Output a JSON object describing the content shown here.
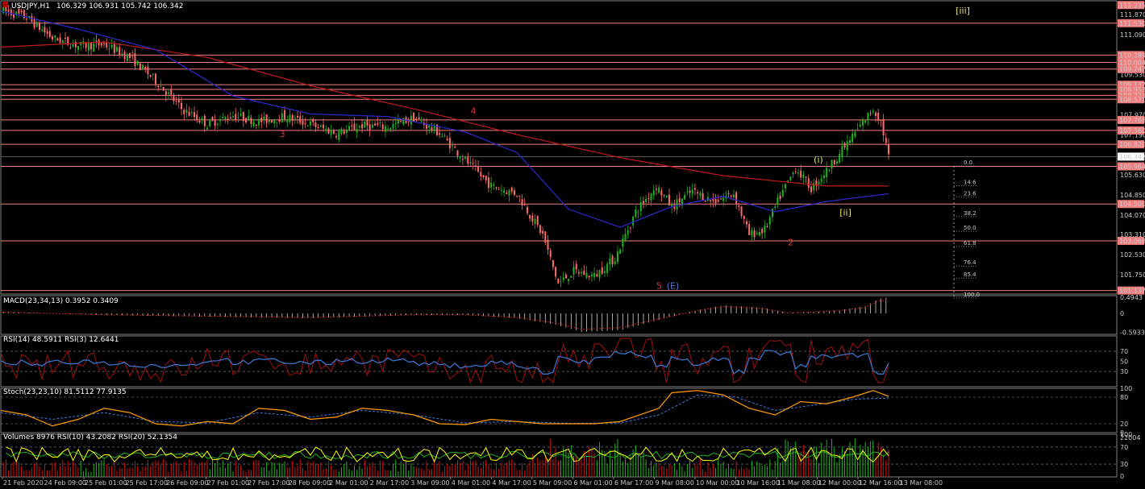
{
  "window": {
    "title": "USDJPY,H1",
    "ohlc": "106.329 106.931 105.742 106.342"
  },
  "colors": {
    "background": "#000000",
    "grid_border": "#808080",
    "bull_candle": "#1fb31f",
    "bear_candle": "#ff6b6b",
    "ma_slow": "#c01a1a",
    "ma_mid": "#2a2ad0",
    "resistance_line": "#f08080",
    "price_tag_bg": "#f08080",
    "current_tag_bg": "#ffffff",
    "wave_red": "#e03030",
    "wave_yellow": "#e8e070",
    "macd_hist": "#d0d0d0",
    "macd_signal": "#c01a1a",
    "rsi14": "#3a7ad8",
    "rsi3": "#a01010",
    "stoch_main": "#ff9a00",
    "stoch_signal": "#3a7ad8",
    "volume_up": "#1fb31f",
    "volume_down": "#d01010",
    "vol_rsi10": "#ffff00",
    "vol_rsi20": "#1fb31f"
  },
  "chart_data": [
    {
      "type": "candlestick",
      "symbol": "USDJPY",
      "timeframe": "H1",
      "title": "USDJPY,H1",
      "ohlc_readout": {
        "open": 106.329,
        "high": 106.931,
        "low": 105.742,
        "close": 106.342
      },
      "ylim": [
        101.0,
        112.4
      ],
      "y_ticks": [
        111.87,
        111.09,
        110.31,
        109.53,
        108.75,
        107.97,
        107.19,
        106.41,
        105.63,
        104.85,
        104.07,
        103.31,
        102.53,
        101.75
      ],
      "price_tags": [
        112.235,
        111.53,
        110.289,
        110.004,
        109.747,
        109.137,
        108.953,
        108.723,
        108.571,
        107.768,
        107.36,
        106.82,
        105.964,
        104.5,
        103.068,
        101.137
      ],
      "horizontal_levels": [
        111.53,
        110.289,
        110.004,
        109.747,
        109.137,
        108.953,
        108.723,
        108.571,
        107.768,
        107.36,
        106.82,
        105.964,
        104.5,
        103.068,
        101.137
      ],
      "current_price": 106.342,
      "x_tick_labels": [
        "21 Feb 2020",
        "24 Feb 09:00",
        "25 Feb 01:00",
        "25 Feb 17:00",
        "26 Feb 09:00",
        "27 Feb 01:00",
        "27 Feb 17:00",
        "28 Feb 09:00",
        "2 Mar 01:00",
        "2 Mar 17:00",
        "3 Mar 09:00",
        "4 Mar 01:00",
        "4 Mar 17:00",
        "5 Mar 09:00",
        "6 Mar 01:00",
        "6 Mar 17:00",
        "9 Mar 08:00",
        "10 Mar 00:00",
        "10 Mar 16:00",
        "11 Mar 08:00",
        "12 Mar 00:00",
        "12 Mar 16:00",
        "13 Mar 08:00"
      ],
      "price_path": [
        [
          0,
          112.05
        ],
        [
          10,
          111.75
        ],
        [
          20,
          110.95
        ],
        [
          30,
          110.65
        ],
        [
          40,
          110.7
        ],
        [
          50,
          110.2
        ],
        [
          60,
          109.3
        ],
        [
          70,
          108.2
        ],
        [
          80,
          107.6
        ],
        [
          90,
          107.95
        ],
        [
          100,
          107.7
        ],
        [
          110,
          107.9
        ],
        [
          120,
          107.6
        ],
        [
          130,
          107.25
        ],
        [
          140,
          107.55
        ],
        [
          150,
          107.5
        ],
        [
          160,
          107.85
        ],
        [
          170,
          107.25
        ],
        [
          180,
          106.2
        ],
        [
          190,
          105.2
        ],
        [
          200,
          104.9
        ],
        [
          210,
          103.3
        ],
        [
          216,
          101.4
        ],
        [
          222,
          101.9
        ],
        [
          230,
          101.7
        ],
        [
          238,
          102.4
        ],
        [
          246,
          104.2
        ],
        [
          254,
          105.2
        ],
        [
          260,
          104.4
        ],
        [
          268,
          105.0
        ],
        [
          276,
          104.6
        ],
        [
          284,
          104.9
        ],
        [
          290,
          103.3
        ],
        [
          296,
          103.5
        ],
        [
          302,
          104.8
        ],
        [
          308,
          105.9
        ],
        [
          314,
          105.1
        ],
        [
          320,
          105.8
        ],
        [
          326,
          106.6
        ],
        [
          332,
          107.4
        ],
        [
          338,
          108.2
        ],
        [
          341,
          107.7
        ],
        [
          344,
          106.34
        ]
      ],
      "ma_slow_path": [
        [
          0,
          110.6
        ],
        [
          40,
          110.8
        ],
        [
          80,
          110.2
        ],
        [
          120,
          109.1
        ],
        [
          160,
          108.2
        ],
        [
          200,
          107.2
        ],
        [
          240,
          106.3
        ],
        [
          280,
          105.6
        ],
        [
          320,
          105.2
        ],
        [
          344,
          105.2
        ]
      ],
      "ma_mid_path": [
        [
          0,
          112.0
        ],
        [
          30,
          111.3
        ],
        [
          60,
          110.5
        ],
        [
          90,
          108.7
        ],
        [
          120,
          108.0
        ],
        [
          150,
          107.9
        ],
        [
          180,
          107.3
        ],
        [
          200,
          106.5
        ],
        [
          220,
          104.3
        ],
        [
          240,
          103.6
        ],
        [
          260,
          104.4
        ],
        [
          280,
          104.8
        ],
        [
          300,
          104.2
        ],
        [
          320,
          104.6
        ],
        [
          344,
          104.9
        ]
      ],
      "wave_labels": [
        {
          "text": "3",
          "x": 108,
          "y": 107.1,
          "color": "#e03030"
        },
        {
          "text": "4",
          "x": 182,
          "y": 108.0,
          "color": "#e03030"
        },
        {
          "text": "5",
          "x": 254,
          "y": 101.2,
          "color": "#e03030"
        },
        {
          "text": "(E)",
          "x": 258,
          "y": 101.2,
          "color": "#5a7ad8"
        },
        {
          "text": "2",
          "x": 305,
          "y": 102.9,
          "color": "#e03030"
        },
        {
          "text": "(i)",
          "x": 315,
          "y": 106.1,
          "color": "#e8e070"
        },
        {
          "text": "[ii]",
          "x": 325,
          "y": 104.05,
          "color": "#e8e070"
        },
        {
          "text": "[iii]",
          "x": 370,
          "y": 111.9,
          "color": "#e8e070"
        }
      ],
      "fibonacci": {
        "levels": [
          "0.0",
          "14.6",
          "23.6",
          "38.2",
          "50.0",
          "61.8",
          "76.4",
          "85.4",
          "100.0"
        ],
        "prices": [
          105.98,
          105.21,
          104.77,
          104.01,
          103.44,
          102.85,
          102.09,
          101.62,
          100.85
        ]
      }
    },
    {
      "type": "bar",
      "title": "MACD(23,34,13) 0.3952 0.3409",
      "name": "MACD(23,34,13)",
      "values_readout": [
        0.3952,
        0.3409
      ],
      "y_ticks": [
        0.4943,
        0.0,
        -0.5933
      ],
      "ylim": [
        -0.65,
        0.55
      ],
      "hist_path": [
        [
          0,
          0.05
        ],
        [
          40,
          -0.05
        ],
        [
          80,
          -0.1
        ],
        [
          120,
          -0.15
        ],
        [
          160,
          -0.05
        ],
        [
          180,
          -0.05
        ],
        [
          200,
          -0.15
        ],
        [
          215,
          -0.35
        ],
        [
          225,
          -0.58
        ],
        [
          240,
          -0.52
        ],
        [
          255,
          -0.2
        ],
        [
          270,
          0.1
        ],
        [
          280,
          0.25
        ],
        [
          295,
          0.18
        ],
        [
          305,
          0.02
        ],
        [
          315,
          0.05
        ],
        [
          325,
          0.1
        ],
        [
          335,
          0.22
        ],
        [
          340,
          0.45
        ],
        [
          344,
          0.5
        ]
      ]
    },
    {
      "type": "line",
      "title": "RSI(14) 48.5911 RSI(3) 12.6441",
      "series": [
        {
          "name": "RSI(14)",
          "readout": 48.5911
        },
        {
          "name": "RSI(3)",
          "readout": 12.6441
        }
      ],
      "y_ticks": [
        70,
        50,
        30
      ],
      "levels": [
        70,
        30
      ],
      "ylim": [
        0,
        100
      ]
    },
    {
      "type": "line",
      "title": "Stoch(23,23,10) 81.5112 77.9135",
      "series": [
        {
          "name": "%K",
          "readout": 81.5112
        },
        {
          "name": "%D",
          "readout": 77.9135
        }
      ],
      "y_ticks": [
        100,
        80,
        20,
        0
      ],
      "levels": [
        80,
        20
      ],
      "ylim": [
        0,
        100
      ],
      "k_path": [
        [
          0,
          50
        ],
        [
          10,
          40
        ],
        [
          20,
          15
        ],
        [
          30,
          30
        ],
        [
          40,
          55
        ],
        [
          50,
          45
        ],
        [
          60,
          20
        ],
        [
          70,
          15
        ],
        [
          80,
          25
        ],
        [
          90,
          20
        ],
        [
          100,
          55
        ],
        [
          110,
          50
        ],
        [
          120,
          30
        ],
        [
          130,
          35
        ],
        [
          140,
          55
        ],
        [
          150,
          50
        ],
        [
          160,
          40
        ],
        [
          170,
          20
        ],
        [
          180,
          18
        ],
        [
          190,
          30
        ],
        [
          200,
          25
        ],
        [
          210,
          20
        ],
        [
          220,
          20
        ],
        [
          230,
          20
        ],
        [
          240,
          25
        ],
        [
          255,
          55
        ],
        [
          260,
          90
        ],
        [
          270,
          95
        ],
        [
          280,
          85
        ],
        [
          290,
          55
        ],
        [
          300,
          40
        ],
        [
          310,
          70
        ],
        [
          320,
          65
        ],
        [
          330,
          80
        ],
        [
          338,
          95
        ],
        [
          344,
          82
        ]
      ],
      "d_path": [
        [
          0,
          45
        ],
        [
          20,
          30
        ],
        [
          40,
          45
        ],
        [
          60,
          25
        ],
        [
          80,
          22
        ],
        [
          100,
          45
        ],
        [
          120,
          35
        ],
        [
          140,
          50
        ],
        [
          160,
          40
        ],
        [
          180,
          22
        ],
        [
          200,
          25
        ],
        [
          220,
          21
        ],
        [
          240,
          22
        ],
        [
          255,
          40
        ],
        [
          270,
          85
        ],
        [
          285,
          80
        ],
        [
          300,
          50
        ],
        [
          315,
          62
        ],
        [
          330,
          75
        ],
        [
          344,
          78
        ]
      ]
    },
    {
      "type": "bar",
      "title": "Volumes 8976 RSI(10) 43.2082 RSI(20) 52.1354",
      "series": [
        {
          "name": "Volumes",
          "readout": 8976
        },
        {
          "name": "RSI(10)",
          "readout": 43.2082
        },
        {
          "name": "RSI(20)",
          "readout": 52.1354
        }
      ],
      "y_ticks": [
        22004,
        100,
        70,
        30,
        0
      ],
      "levels": [
        70,
        30
      ]
    }
  ]
}
